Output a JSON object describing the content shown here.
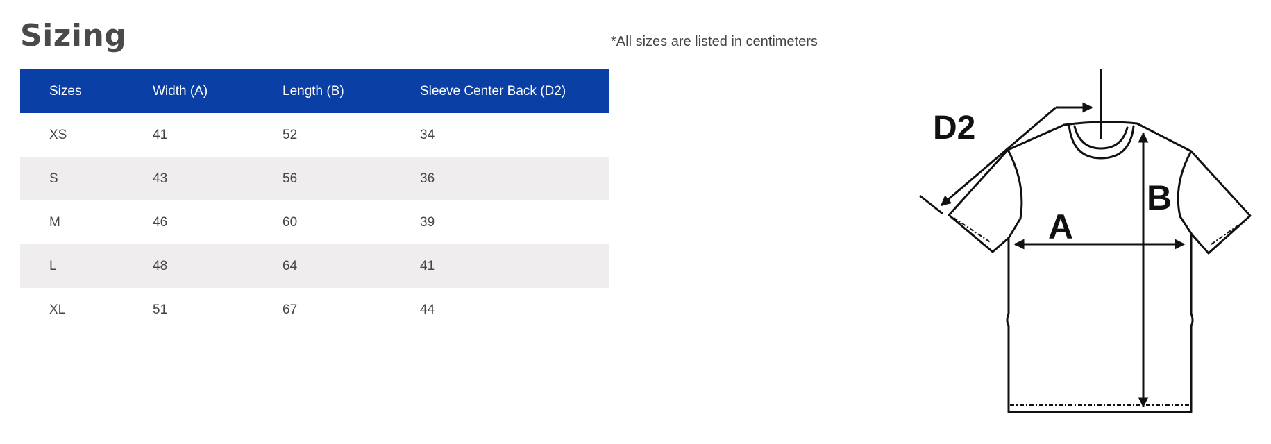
{
  "title": "Sizing",
  "note": "*All sizes are listed in centimeters",
  "table": {
    "headers": [
      "Sizes",
      "Width (A)",
      "Length (B)",
      "Sleeve Center Back (D2)"
    ],
    "rows": [
      [
        "XS",
        "41",
        "52",
        "34"
      ],
      [
        "S",
        "43",
        "56",
        "36"
      ],
      [
        "M",
        "46",
        "60",
        "39"
      ],
      [
        "L",
        "48",
        "64",
        "41"
      ],
      [
        "XL",
        "51",
        "67",
        "44"
      ]
    ]
  },
  "diagram": {
    "labels": {
      "d2": "D2",
      "a": "A",
      "b": "B"
    }
  },
  "colors": {
    "header_bg": "#0a3fa6",
    "header_text": "#ffffff",
    "stripe_bg": "#efeded",
    "title_text": "#4a4a4a"
  }
}
